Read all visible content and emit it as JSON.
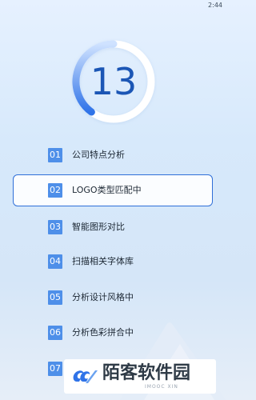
{
  "status_bar": {
    "time": "2:44"
  },
  "progress": {
    "count": "13",
    "arc_fraction": 0.4,
    "colors": {
      "track": "#ffffff",
      "arc_start": "#cfe2ff",
      "arc_end": "#2f73e8",
      "number": "#1b56b5"
    }
  },
  "steps": [
    {
      "num": "01",
      "label": "公司特点分析",
      "active": false
    },
    {
      "num": "02",
      "label": "LOGO类型匹配中",
      "active": true
    },
    {
      "num": "03",
      "label": "智能图形对比",
      "active": false
    },
    {
      "num": "04",
      "label": "扫描相关字体库",
      "active": false
    },
    {
      "num": "05",
      "label": "分析设计风格中",
      "active": false
    },
    {
      "num": "06",
      "label": "分析色彩拼合中",
      "active": false
    },
    {
      "num": "07",
      "label": "",
      "active": false
    }
  ],
  "watermark": {
    "title": "陌客软件园",
    "subtitle": "IMOOC XIN"
  },
  "colors": {
    "accent": "#2f6fd8",
    "badge": "#4e8fe9"
  }
}
